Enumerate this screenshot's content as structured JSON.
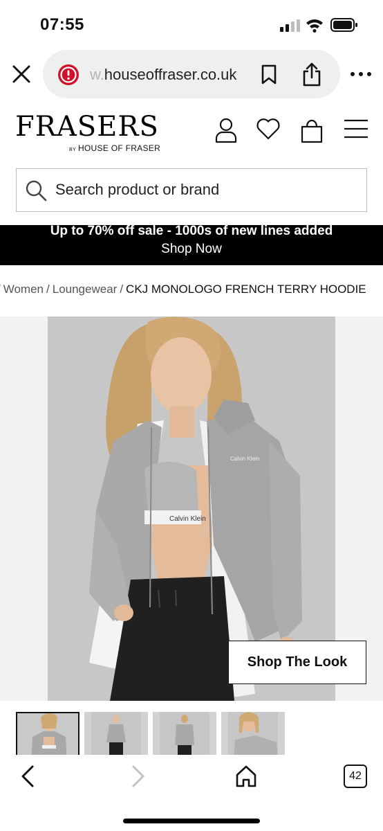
{
  "status_bar": {
    "time": "07:55"
  },
  "browser": {
    "url_faded": "w.",
    "url_main": "houseoffraser.co.uk",
    "tab_count": "42"
  },
  "site": {
    "logo_main": "FRASERS",
    "logo_by": "BY",
    "logo_sub": "HOUSE OF FRASER"
  },
  "search": {
    "placeholder": "Search product or brand"
  },
  "promo": {
    "line1": "Up to 70% off sale - 1000s of new lines added",
    "line2": "Shop Now"
  },
  "breadcrumb": {
    "items": [
      "Women",
      "Loungewear"
    ],
    "current": "CKJ MONOLOGO FRENCH TERRY HOODIE"
  },
  "product": {
    "shop_the_look_label": "Shop The Look",
    "hoodie_print": "Calvin Klein",
    "waistband_text": "Calvin Klein",
    "thumbnail_count": 4,
    "active_thumbnail": 1
  },
  "colors": {
    "promo_bg": "#000000",
    "warning_red": "#d0112b",
    "hoodie_grey": "#a9a9a9",
    "backdrop_grey": "#c7c7c7"
  }
}
